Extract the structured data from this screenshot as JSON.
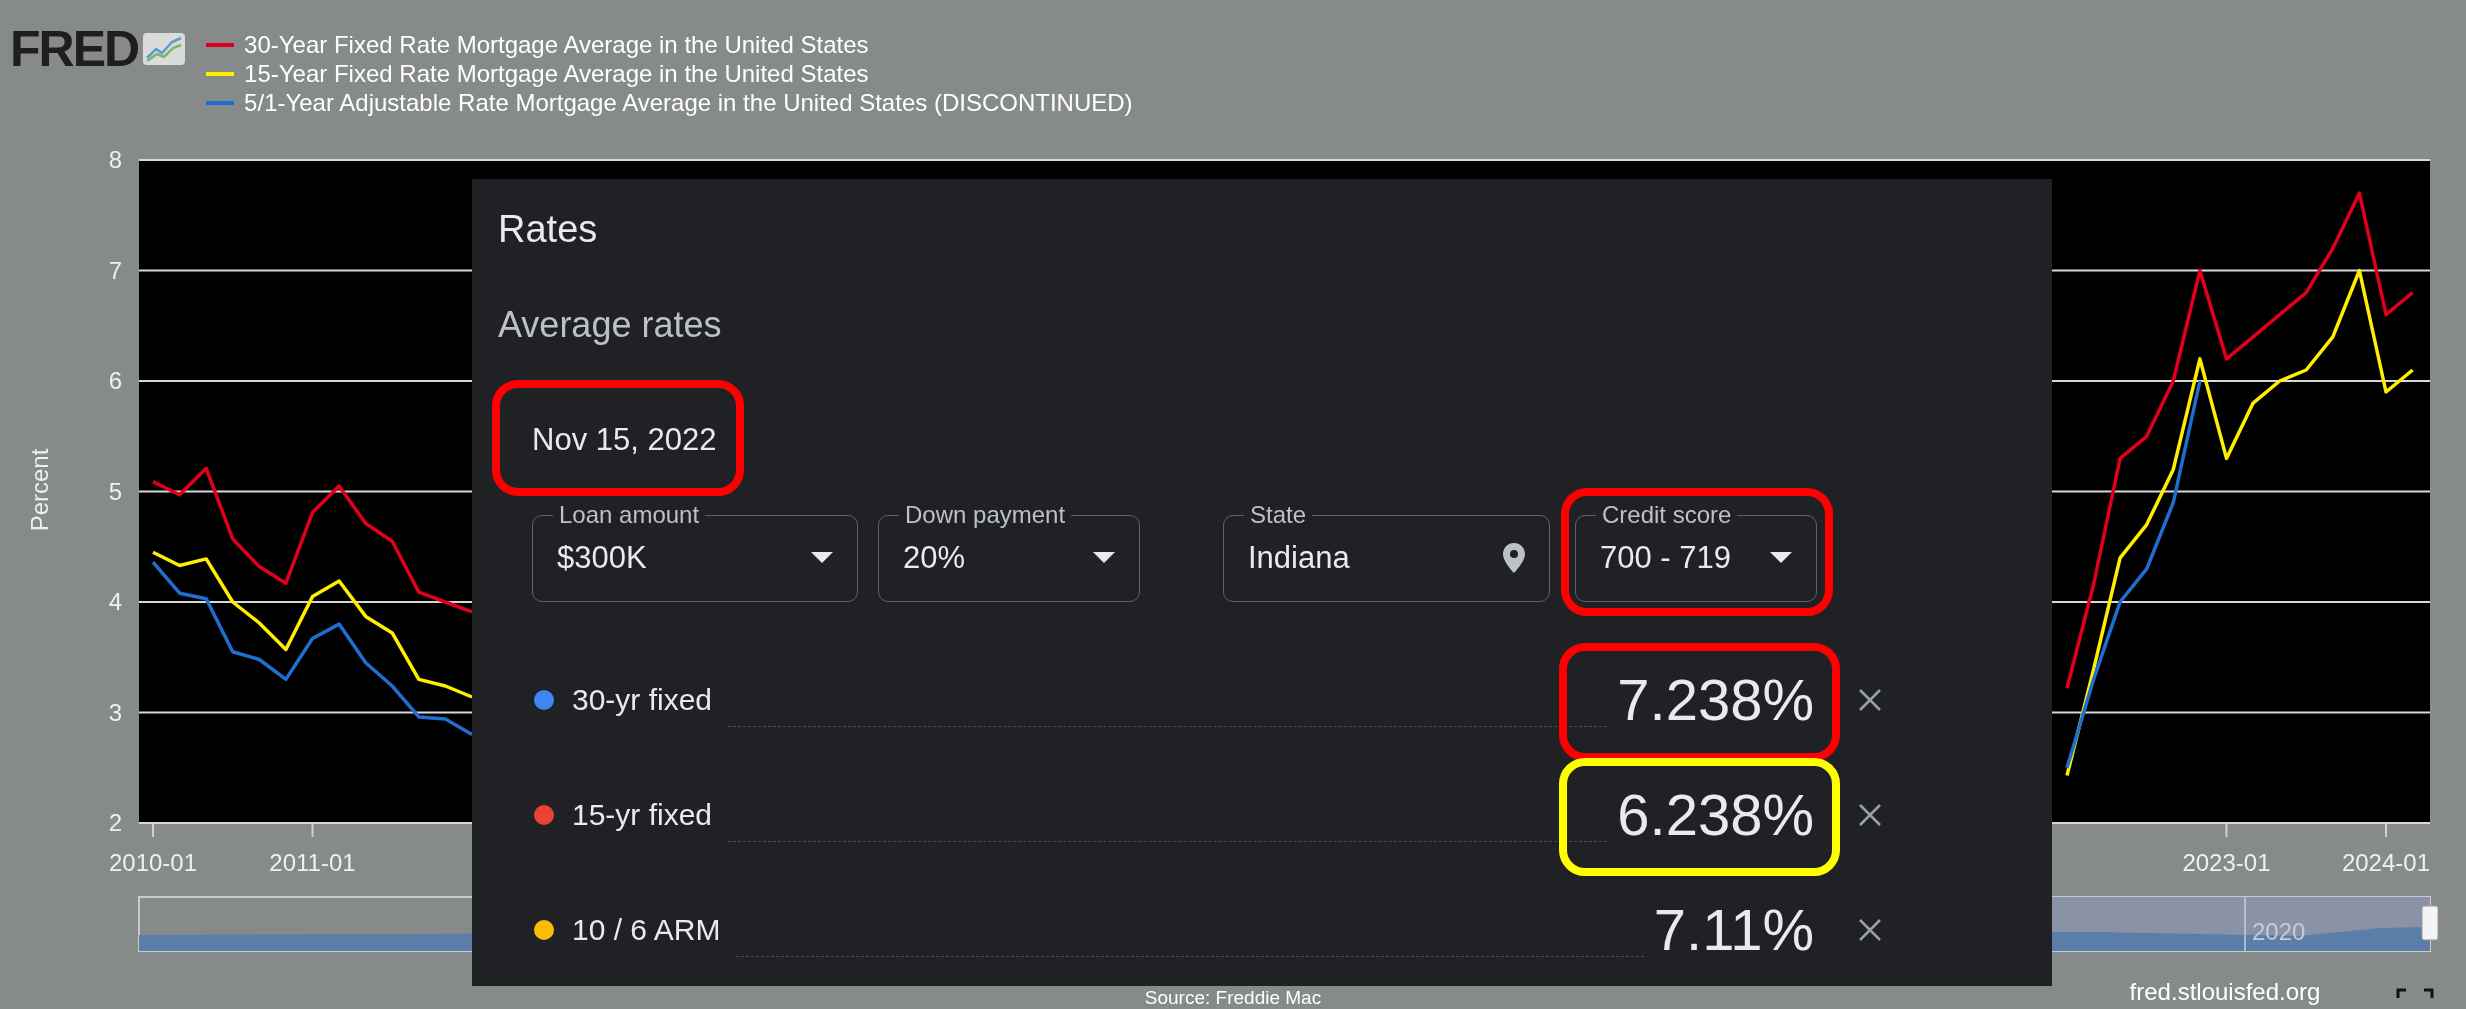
{
  "logo": {
    "text": "FRED"
  },
  "chart": {
    "chart_data": {
      "type": "line",
      "ylabel": "Percent",
      "categories": [
        "2010-01",
        null,
        null,
        null,
        null,
        null,
        "2011-01",
        null,
        null,
        null,
        null,
        null,
        null,
        null,
        null,
        null,
        null,
        null,
        null,
        null,
        null,
        null,
        null,
        null,
        null,
        null,
        null,
        null,
        null,
        null,
        null,
        null,
        null,
        null,
        null,
        null,
        null,
        null,
        null,
        null,
        null,
        null,
        null,
        null,
        null,
        null,
        null,
        null,
        null,
        null,
        null,
        null,
        null,
        null,
        null,
        null,
        null,
        null,
        null,
        null,
        null,
        null,
        null,
        null,
        null,
        null,
        null,
        null,
        null,
        null,
        null,
        null,
        null,
        null,
        null,
        null,
        null,
        null,
        "2023-01",
        null,
        null,
        null,
        null,
        null,
        "2024-01",
        null
      ],
      "series": [
        {
          "name": "30-Year Fixed Rate Mortgage Average in the United States",
          "color": "#e0001b",
          "values": [
            5.09,
            4.97,
            5.21,
            4.57,
            4.32,
            4.17,
            4.81,
            5.05,
            4.71,
            4.55,
            4.09,
            4.0,
            3.91,
            null,
            null,
            null,
            null,
            null,
            null,
            null,
            null,
            null,
            null,
            null,
            null,
            null,
            null,
            null,
            null,
            null,
            null,
            null,
            null,
            null,
            null,
            null,
            null,
            null,
            null,
            null,
            null,
            null,
            null,
            null,
            null,
            null,
            null,
            null,
            null,
            null,
            null,
            null,
            null,
            null,
            null,
            null,
            null,
            null,
            null,
            null,
            null,
            null,
            null,
            null,
            null,
            null,
            null,
            null,
            null,
            null,
            null,
            null,
            3.22,
            4.16,
            5.3,
            5.5,
            6.0,
            7.0,
            6.2,
            6.4,
            6.6,
            6.8,
            7.2,
            7.7,
            6.6,
            6.8
          ]
        },
        {
          "name": "15-Year Fixed Rate Mortgage Average in the United States",
          "color": "#ffee00",
          "values": [
            4.45,
            4.33,
            4.39,
            4.0,
            3.81,
            3.57,
            4.05,
            4.19,
            3.87,
            3.72,
            3.3,
            3.24,
            3.14,
            null,
            null,
            null,
            null,
            null,
            null,
            null,
            null,
            null,
            null,
            null,
            null,
            null,
            null,
            null,
            null,
            null,
            null,
            null,
            null,
            null,
            null,
            null,
            null,
            null,
            null,
            null,
            null,
            null,
            null,
            null,
            null,
            null,
            null,
            null,
            null,
            null,
            null,
            null,
            null,
            null,
            null,
            null,
            null,
            null,
            null,
            null,
            null,
            null,
            null,
            null,
            null,
            null,
            null,
            null,
            null,
            null,
            null,
            null,
            2.43,
            3.39,
            4.4,
            4.7,
            5.2,
            6.2,
            5.3,
            5.8,
            6.0,
            6.1,
            6.4,
            7.0,
            5.9,
            6.1
          ]
        },
        {
          "name": "5/1-Year Adjustable Rate Mortgage Average in the United States (DISCONTINUED)",
          "color": "#1f6fd1",
          "values": [
            4.36,
            4.08,
            4.03,
            3.55,
            3.48,
            3.3,
            3.67,
            3.8,
            3.45,
            3.24,
            2.96,
            2.94,
            2.8,
            null,
            null,
            null,
            null,
            null,
            null,
            null,
            null,
            null,
            null,
            null,
            null,
            null,
            null,
            null,
            null,
            null,
            null,
            null,
            null,
            null,
            null,
            null,
            null,
            null,
            null,
            null,
            null,
            null,
            null,
            null,
            null,
            null,
            null,
            null,
            null,
            null,
            null,
            null,
            null,
            null,
            null,
            null,
            null,
            null,
            null,
            null,
            null,
            null,
            null,
            null,
            null,
            null,
            null,
            null,
            null,
            null,
            null,
            null,
            2.5,
            3.3,
            4.0,
            4.3,
            4.9,
            6.0,
            null,
            null,
            null,
            null,
            null,
            null,
            null,
            null
          ]
        }
      ],
      "ylim": [
        2,
        8
      ],
      "yticks": [
        2,
        3,
        4,
        5,
        6,
        7,
        8
      ],
      "grid": true
    },
    "navigator": {
      "label": "2020"
    },
    "source": "Source: Freddie Mac"
  },
  "footer": {
    "site": "fred.stlouisfed.org"
  },
  "rates_panel": {
    "title": "Rates",
    "subtitle": "Average rates",
    "date": "Nov 15, 2022",
    "date_highlight": {
      "color": "#ff0000"
    },
    "fields": [
      {
        "label": "Loan amount",
        "value": "$300K",
        "kind": "dropdown"
      },
      {
        "label": "Down payment",
        "value": "20%",
        "kind": "dropdown"
      },
      {
        "label": "State",
        "value": "Indiana",
        "kind": "location"
      },
      {
        "label": "Credit score",
        "value": "700 - 719",
        "kind": "dropdown",
        "highlight": {
          "color": "#ff0000"
        }
      }
    ],
    "rates": [
      {
        "name": "30-yr fixed",
        "color": "#4285f4",
        "value": "7.238%",
        "highlight": {
          "color": "#ff0000"
        }
      },
      {
        "name": "15-yr fixed",
        "color": "#ea4335",
        "value": "6.238%",
        "highlight": {
          "color": "#ffff00"
        }
      },
      {
        "name": "10 / 6 ARM",
        "color": "#fbbc04",
        "value": "7.11%"
      }
    ]
  }
}
